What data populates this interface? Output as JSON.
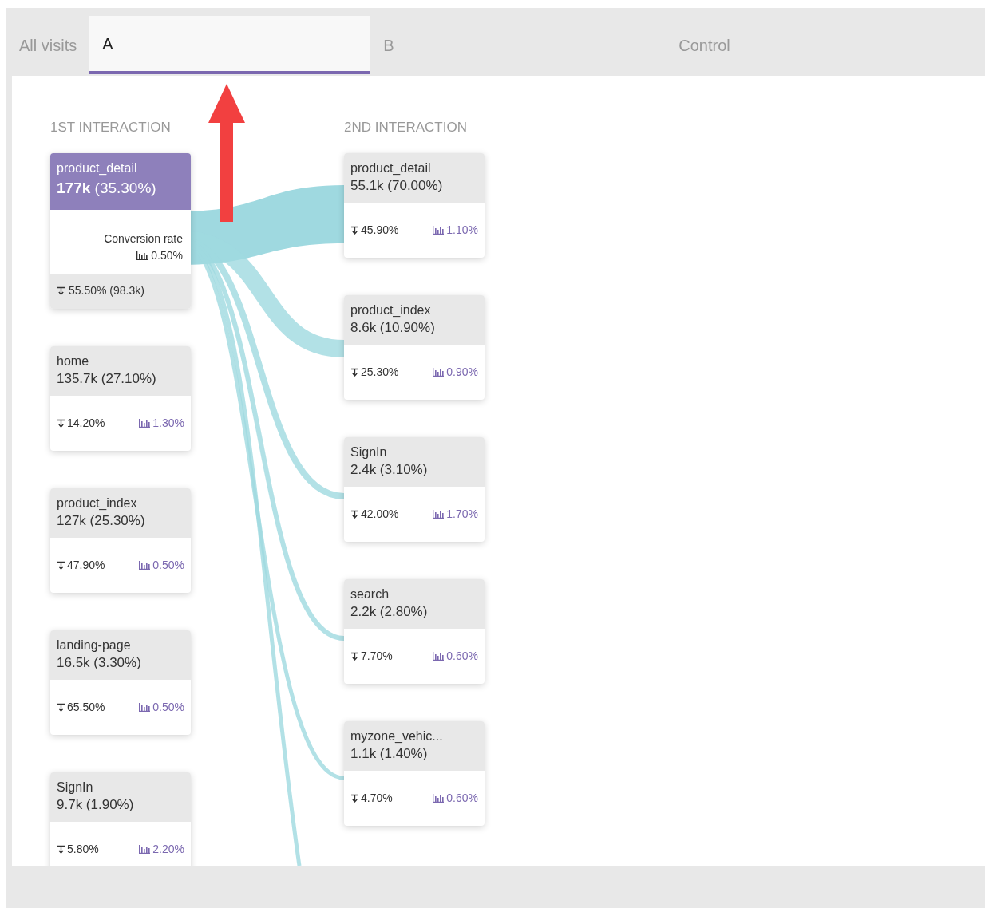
{
  "tabs": [
    {
      "label": "All visits",
      "selected": false
    },
    {
      "label": "A",
      "selected": true
    },
    {
      "label": "B",
      "selected": false
    },
    {
      "label": "Control",
      "selected": false
    }
  ],
  "columns": [
    {
      "title": "1ST INTERACTION",
      "cards": [
        {
          "name": "product_detail",
          "count": "177k",
          "share": "(35.30%)",
          "selected": true,
          "conversion_label": "Conversion rate",
          "conversion": "0.50%",
          "exit": "55.50% (98.3k)"
        },
        {
          "name": "home",
          "count": "135.7k",
          "share": "(27.10%)",
          "selected": false,
          "exit": "14.20%",
          "conversion": "1.30%"
        },
        {
          "name": "product_index",
          "count": "127k",
          "share": "(25.30%)",
          "selected": false,
          "exit": "47.90%",
          "conversion": "0.50%"
        },
        {
          "name": "landing-page",
          "count": "16.5k",
          "share": "(3.30%)",
          "selected": false,
          "exit": "65.50%",
          "conversion": "0.50%"
        },
        {
          "name": "SignIn",
          "count": "9.7k",
          "share": "(1.90%)",
          "selected": false,
          "exit": "5.80%",
          "conversion": "2.20%"
        }
      ]
    },
    {
      "title": "2ND INTERACTION",
      "cards": [
        {
          "name": "product_detail",
          "count": "55.1k",
          "share": "(70.00%)",
          "selected": false,
          "exit": "45.90%",
          "conversion": "1.10%"
        },
        {
          "name": "product_index",
          "count": "8.6k",
          "share": "(10.90%)",
          "selected": false,
          "exit": "25.30%",
          "conversion": "0.90%"
        },
        {
          "name": "SignIn",
          "count": "2.4k",
          "share": "(3.10%)",
          "selected": false,
          "exit": "42.00%",
          "conversion": "1.70%"
        },
        {
          "name": "search",
          "count": "2.2k",
          "share": "(2.80%)",
          "selected": false,
          "exit": "7.70%",
          "conversion": "0.60%"
        },
        {
          "name": "myzone_vehic...",
          "count": "1.1k",
          "share": "(1.40%)",
          "selected": false,
          "exit": "4.70%",
          "conversion": "0.60%"
        }
      ]
    }
  ]
}
